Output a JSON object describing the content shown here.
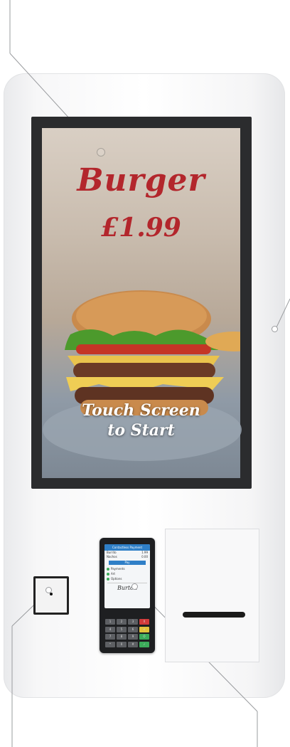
{
  "screen": {
    "headline": "Burger",
    "price": "£1.99",
    "cta_line1": "Touch Screen",
    "cta_line2": "to Start"
  },
  "terminal": {
    "header": "Contactless Payment",
    "rows": [
      {
        "label": "Burrito",
        "value": "1.99"
      },
      {
        "label": "Nachos",
        "value": "0.00"
      }
    ],
    "pay_button": "Pay",
    "options": [
      "Payments",
      "Art",
      "Options"
    ],
    "signature": "Burton",
    "keys": [
      "1",
      "2",
      "3",
      "X",
      "4",
      "5",
      "6",
      "<",
      "7",
      "8",
      "9",
      "O",
      "*",
      "0",
      "#",
      "✓"
    ]
  },
  "colors": {
    "headline": "#b3262c",
    "bezel": "#2b2c2e",
    "kiosk_body": "#ffffff",
    "terminal_accent": "#2f7fc7"
  }
}
